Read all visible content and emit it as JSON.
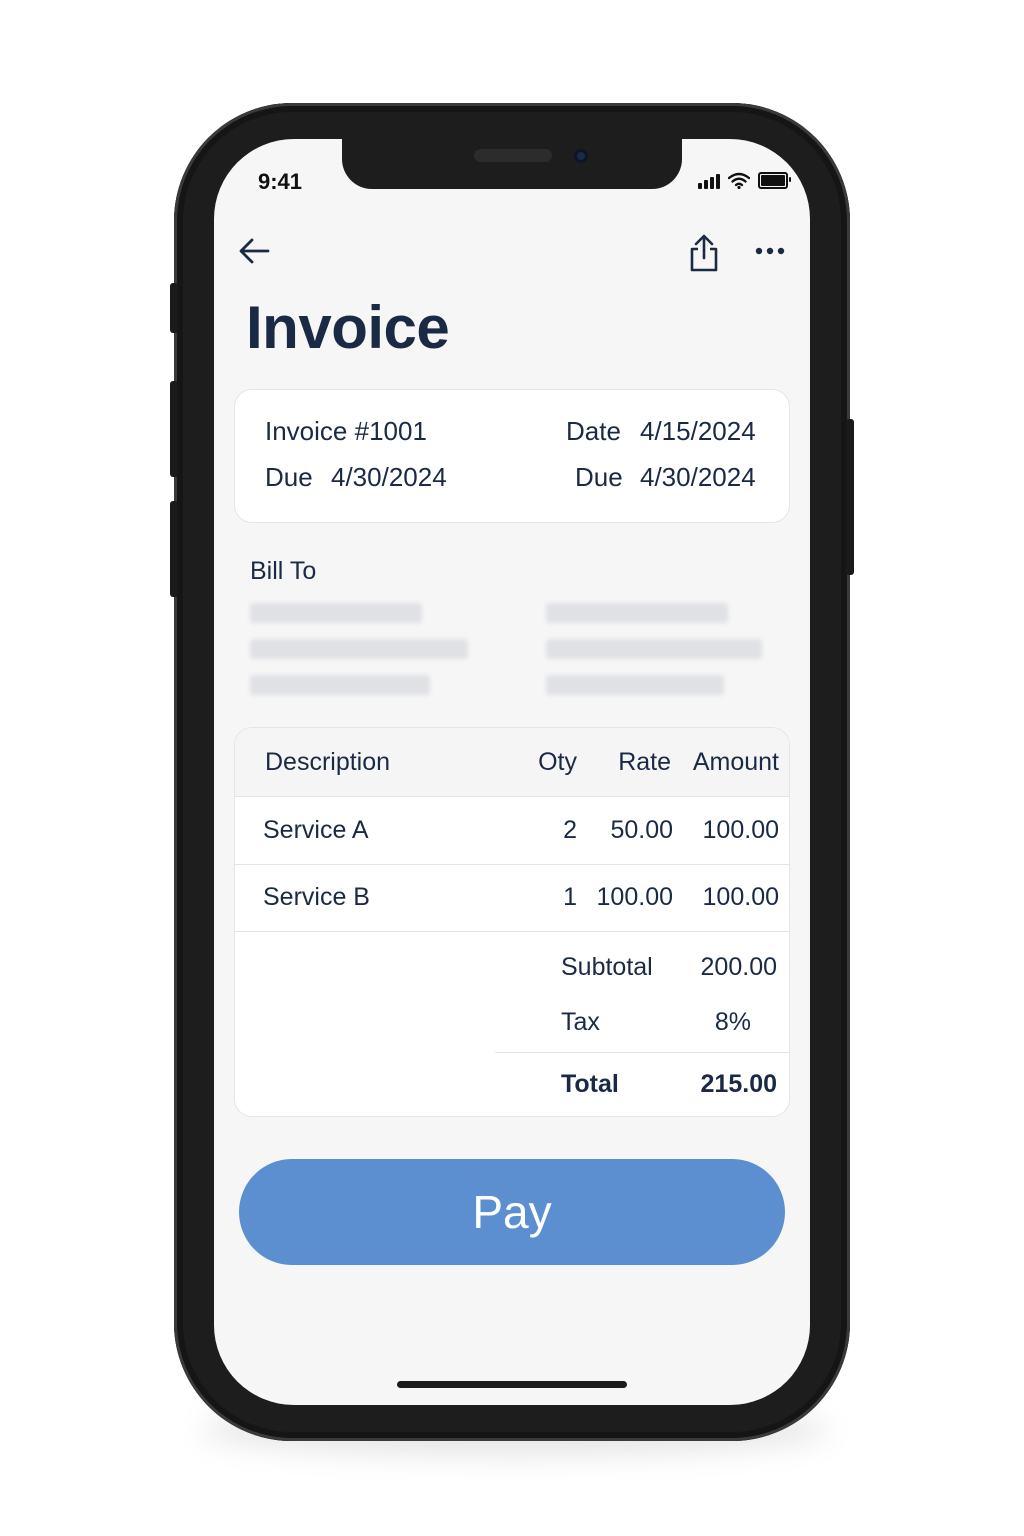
{
  "status_bar": {
    "time": "9:41"
  },
  "nav": {
    "back_icon": "arrow-left-icon",
    "share_icon": "share-icon",
    "more_icon": "ellipsis-icon"
  },
  "page": {
    "title": "Invoice"
  },
  "invoice_meta": {
    "number_label": "Invoice #1001",
    "due_label": "Due",
    "due_value": "4/30/2024",
    "date_label": "Date",
    "date_value": "4/15/2024",
    "due2_label": "Due",
    "due2_value": "4/30/2024"
  },
  "bill_to": {
    "label": "Bill To"
  },
  "items_table": {
    "headers": {
      "description": "Description",
      "qty": "Oty",
      "rate": "Rate",
      "amount": "Amount"
    },
    "rows": [
      {
        "description": "Service A",
        "qty": "2",
        "rate": "50.00",
        "amount": "100.00"
      },
      {
        "description": "Service B",
        "qty": "1",
        "rate": "100.00",
        "amount": "100.00"
      }
    ],
    "summary": {
      "subtotal_label": "Subtotal",
      "subtotal_value": "200.00",
      "tax_label": "Tax",
      "tax_value": "8%",
      "total_label": "Total",
      "total_value": "215.00"
    }
  },
  "pay_button": {
    "label": "Pay"
  },
  "colors": {
    "title": "#1b2a44",
    "pay_button": "#5b8fd0",
    "background": "#f6f6f7",
    "card": "#ffffff"
  }
}
